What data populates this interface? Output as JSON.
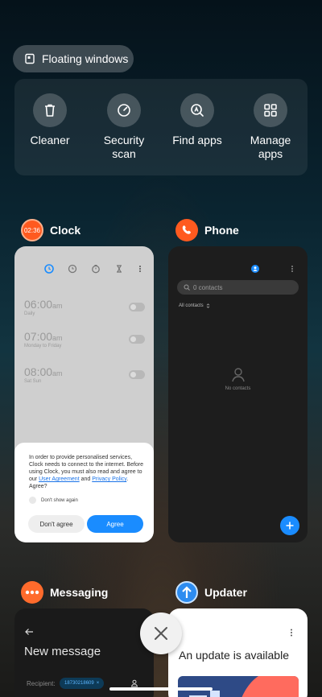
{
  "floating_windows": {
    "label": "Floating windows",
    "icon": "floating-window-icon"
  },
  "tools": [
    {
      "label_lines": [
        "Cleaner"
      ],
      "icon": "trash-icon"
    },
    {
      "label_lines": [
        "Security",
        "scan"
      ],
      "icon": "security-scan-icon"
    },
    {
      "label_lines": [
        "Find apps"
      ],
      "icon": "find-apps-icon"
    },
    {
      "label_lines": [
        "Manage",
        "apps"
      ],
      "icon": "manage-apps-icon"
    }
  ],
  "clock": {
    "app_name": "Clock",
    "icon_time": "02:36",
    "alarms": [
      {
        "time": "06:00",
        "ampm": "am",
        "repeat": "Daily"
      },
      {
        "time": "07:00",
        "ampm": "am",
        "repeat": "Monday to Friday"
      },
      {
        "time": "08:00",
        "ampm": "am",
        "repeat": "Sat Sun"
      }
    ],
    "dialog": {
      "text_before": "In order to provide personalised services, Clock needs to connect to the internet. Before using Clock, you must also read and agree to our ",
      "link1": "User Agreement",
      "text_mid": " and ",
      "link2": "Privacy Policy",
      "text_after": ". Agree?",
      "dont_show": "Don't show again",
      "disagree": "Don't agree",
      "agree": "Agree"
    }
  },
  "phone": {
    "app_name": "Phone",
    "search_placeholder": "0 contacts",
    "filter": "All contacts",
    "empty": "No contacts"
  },
  "messaging": {
    "app_name": "Messaging",
    "title": "New message",
    "recipient_label": "Recipient:",
    "recipient_chip": "18730218609"
  },
  "updater": {
    "app_name": "Updater",
    "headline": "An update is available"
  },
  "colors": {
    "accent_blue": "#1a8cff",
    "clock_orange": "#ff5a1f",
    "messaging_orange": "#ff6b2c",
    "updater_blue": "#2d8cf0"
  }
}
